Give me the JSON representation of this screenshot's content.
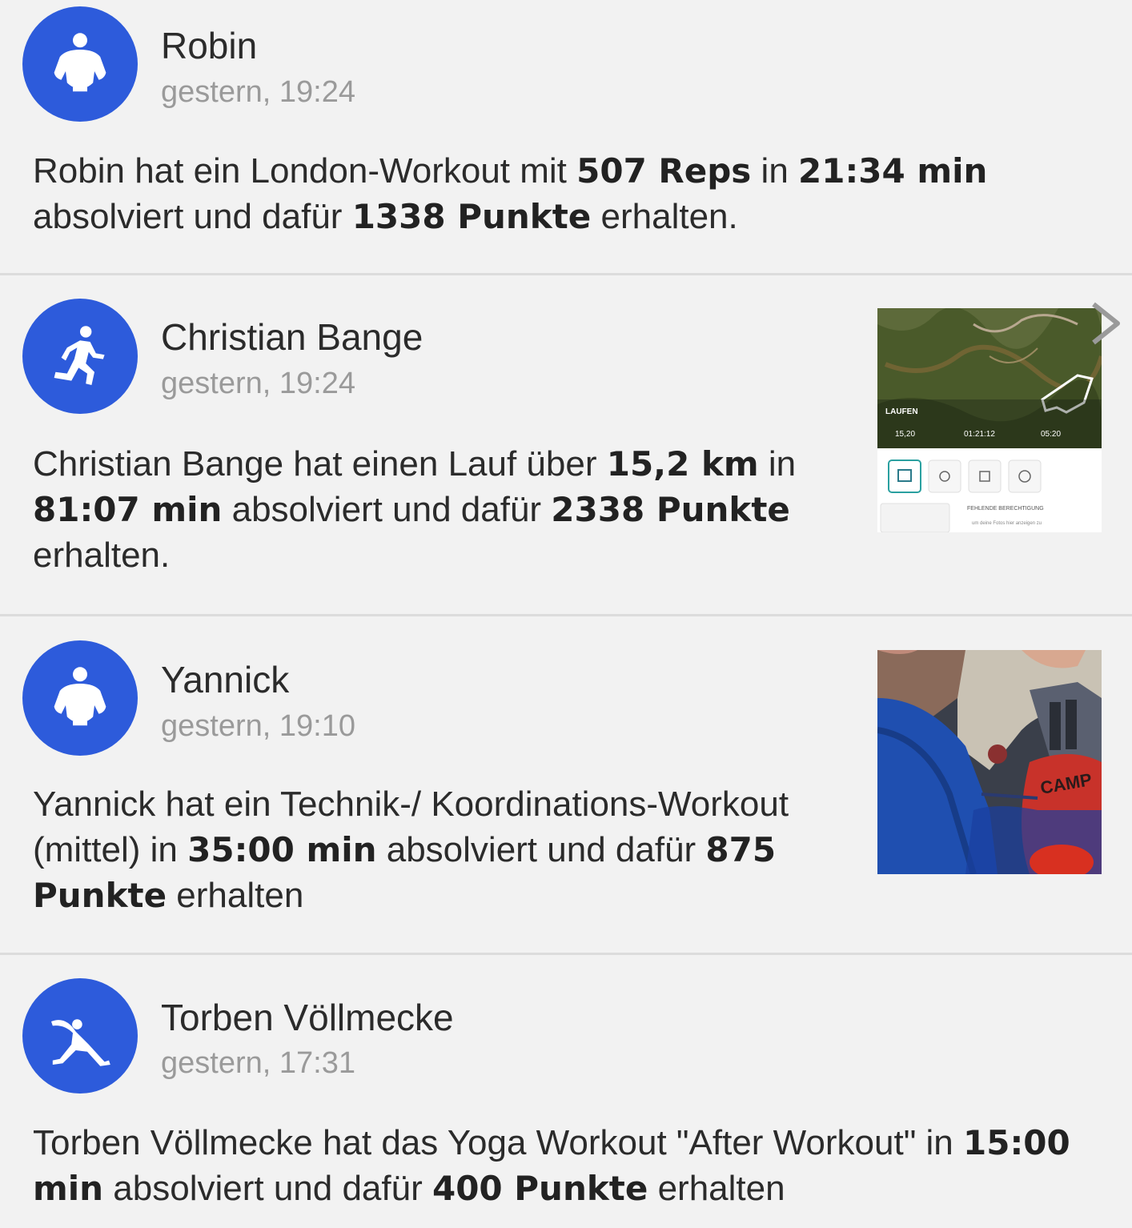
{
  "feed": {
    "items": [
      {
        "name": "Robin",
        "time": "gestern, 19:24",
        "avatar_icon": "muscle-man-icon",
        "text": [
          {
            "t": "Robin  hat ein London-Workout mit "
          },
          {
            "t": "507 Reps",
            "b": true
          },
          {
            "t": " in "
          },
          {
            "t": "21:34 min",
            "b": true
          },
          {
            "t": " absolviert und dafür "
          },
          {
            "t": "1338 Punkte",
            "b": true
          },
          {
            "t": " erhalten."
          }
        ]
      },
      {
        "name": "Christian Bange",
        "time": "gestern, 19:24",
        "avatar_icon": "runner-icon",
        "text": [
          {
            "t": "Christian Bange hat einen Lauf über "
          },
          {
            "t": "15,2 km",
            "b": true
          },
          {
            "t": " in "
          },
          {
            "t": "81:07 min",
            "b": true
          },
          {
            "t": " absolviert und dafür "
          },
          {
            "t": "2338 Punkte",
            "b": true
          },
          {
            "t": " erhalten."
          }
        ],
        "thumbnail": {
          "label": "LAUFEN",
          "stats": [
            "15,20",
            "01:21:12",
            "05:20"
          ],
          "notice": "FEHLENDE BERECHTIGUNG",
          "notice_sub": "um deine Fotos hier anzeigen zu"
        }
      },
      {
        "name": "Yannick",
        "time": "gestern, 19:10",
        "avatar_icon": "muscle-man-icon",
        "text": [
          {
            "t": "Yannick hat ein Technik-/ Koordinations-Workout (mittel)  in "
          },
          {
            "t": "35:00 min",
            "b": true
          },
          {
            "t": " absolviert und dafür "
          },
          {
            "t": "875 Punkte",
            "b": true
          },
          {
            "t": " erhalten"
          }
        ]
      },
      {
        "name": "Torben Völlmecke",
        "time": "gestern, 17:31",
        "avatar_icon": "yoga-pose-icon",
        "text": [
          {
            "t": "Torben Völlmecke  hat das Yoga Workout \"After Workout\" in "
          },
          {
            "t": "15:00 min",
            "b": true
          },
          {
            "t": " absolviert und dafür "
          },
          {
            "t": "400 Punkte",
            "b": true
          },
          {
            "t": " erhalten"
          }
        ]
      }
    ]
  },
  "colors": {
    "avatar_bg": "#2d5bdb",
    "background": "#f2f2f2",
    "divider": "#dcdcdc",
    "time_text": "#9a9a9a"
  }
}
